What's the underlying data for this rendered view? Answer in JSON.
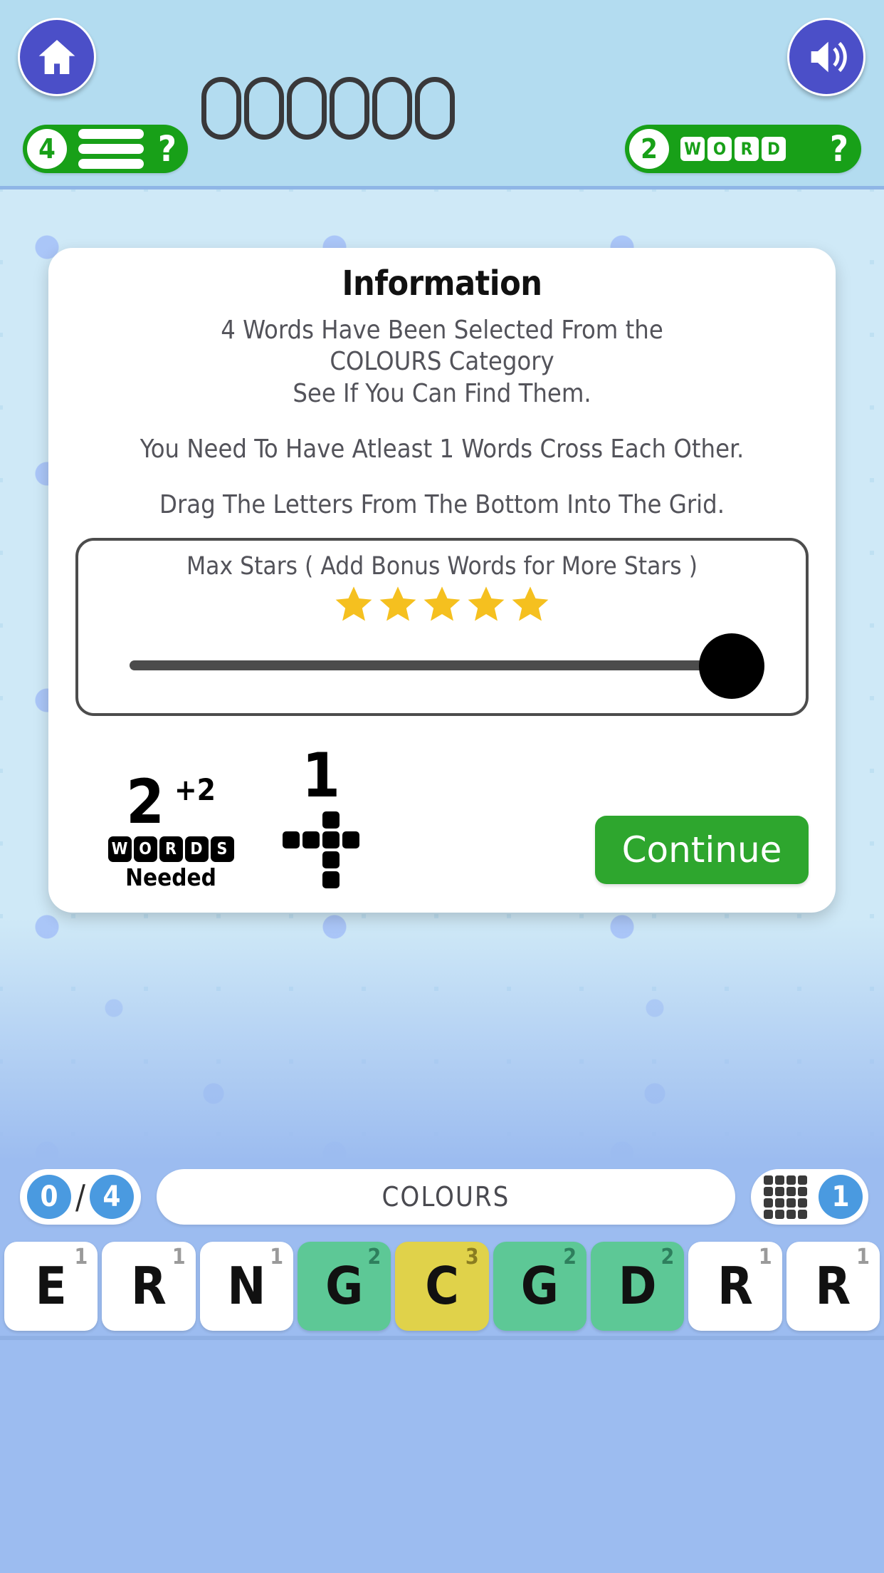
{
  "header": {
    "home_button": "home-icon",
    "sound_button": "sound-icon",
    "hint_pill": {
      "count": "4",
      "icon": "hamburger-icon",
      "question": "?"
    },
    "word_pill": {
      "count": "2",
      "word_letters": [
        "W",
        "O",
        "R",
        "D"
      ],
      "question": "?"
    },
    "word_slots": 6
  },
  "dialog": {
    "title": "Information",
    "intro": "4 Words Have Been Selected From the\nCOLOURS Category\nSee If You Can Find Them.",
    "cross_rule": "You Need To Have Atleast 1 Words Cross Each Other.",
    "drag_rule": "Drag The Letters From The Bottom Into The Grid.",
    "stars_panel": {
      "label": "Max Stars ( Add Bonus Words for More Stars )",
      "stars_filled": 5,
      "stars_total": 5,
      "slider_value": 100
    },
    "stats": {
      "words_needed": "2",
      "words_bonus": "+2",
      "words_badge": [
        "W",
        "O",
        "R",
        "D",
        "S"
      ],
      "needed_label": "Needed",
      "crosses_needed": "1",
      "cross_icon": "crossword-cross-icon"
    },
    "continue_label": "Continue"
  },
  "status_bar": {
    "found": "0",
    "slash": "/",
    "total": "4",
    "category": "COLOURS",
    "cross_icon": "crossword-cross-icon",
    "cross_count": "1"
  },
  "tray": {
    "tiles": [
      {
        "letter": "E",
        "score": "1",
        "color": "white"
      },
      {
        "letter": "R",
        "score": "1",
        "color": "white"
      },
      {
        "letter": "N",
        "score": "1",
        "color": "white"
      },
      {
        "letter": "G",
        "score": "2",
        "color": "green"
      },
      {
        "letter": "C",
        "score": "3",
        "color": "yellow"
      },
      {
        "letter": "G",
        "score": "2",
        "color": "green"
      },
      {
        "letter": "D",
        "score": "2",
        "color": "green"
      },
      {
        "letter": "R",
        "score": "1",
        "color": "white"
      },
      {
        "letter": "R",
        "score": "1",
        "color": "white"
      }
    ]
  },
  "colors": {
    "header_bg": "#b3dcf0",
    "page_bg": "#9cbcf0",
    "pill_green": "#18a018",
    "button_green": "#2ea62e",
    "round_btn_purple": "#4b4fc8",
    "star_gold": "#f5c01f",
    "tile_green": "#5dc896",
    "tile_yellow": "#e0d24a",
    "status_circle_blue": "#4a9ae0"
  }
}
